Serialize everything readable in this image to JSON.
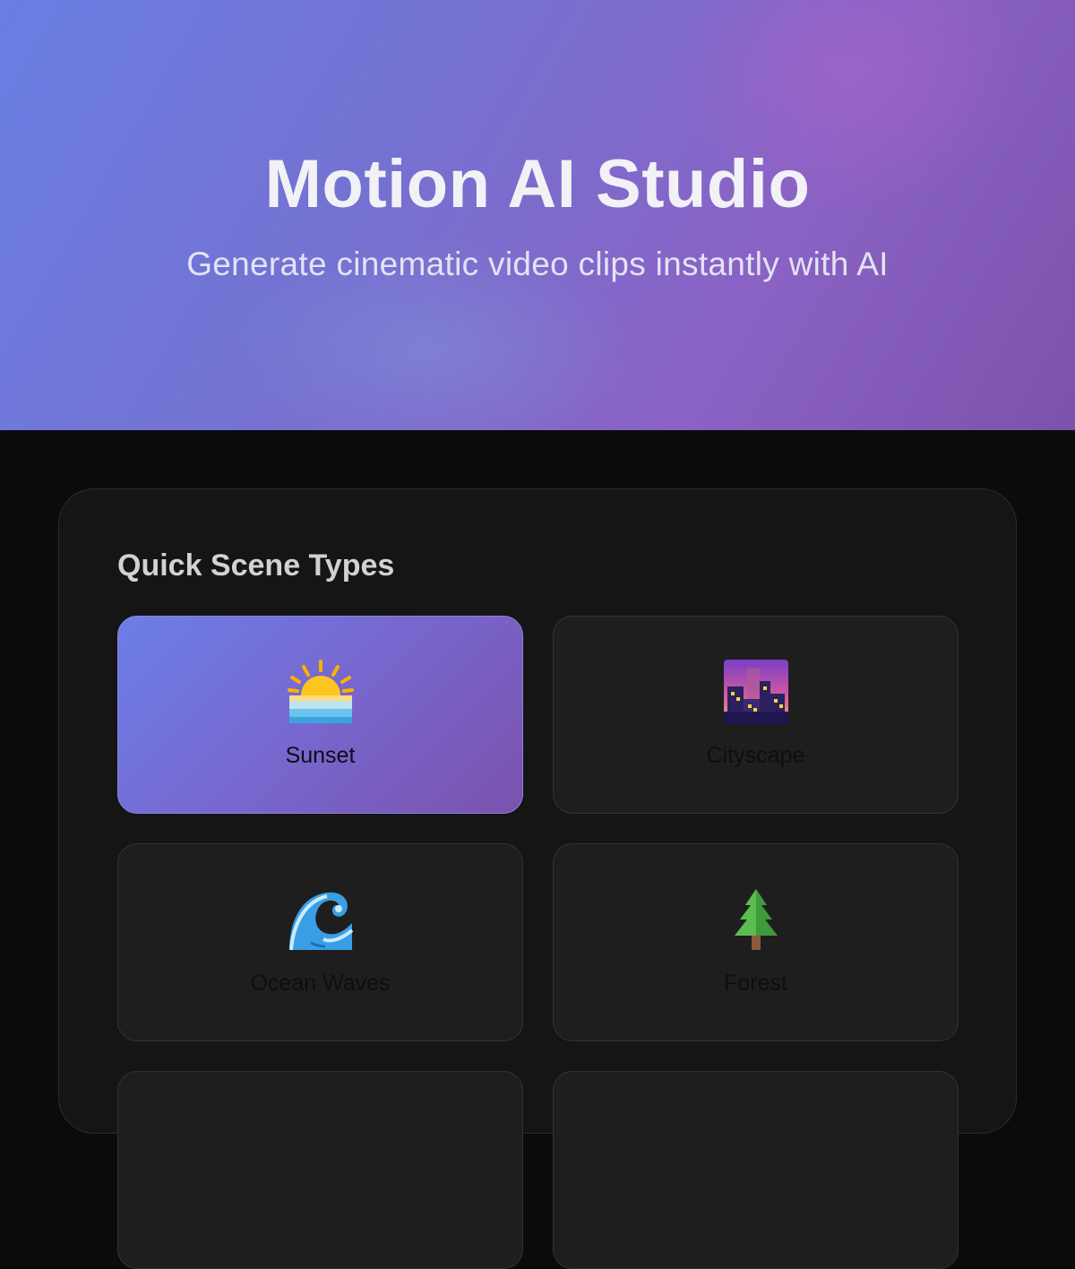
{
  "hero": {
    "title": "Motion AI Studio",
    "subtitle": "Generate cinematic video clips instantly with AI"
  },
  "scenes": {
    "heading": "Quick Scene Types",
    "items": [
      {
        "label": "Sunset",
        "icon": "sunrise-over-water-icon",
        "selected": true
      },
      {
        "label": "Cityscape",
        "icon": "city-dusk-icon",
        "selected": false
      },
      {
        "label": "Ocean Waves",
        "icon": "water-wave-icon",
        "selected": false
      },
      {
        "label": "Forest",
        "icon": "evergreen-tree-icon",
        "selected": false
      }
    ]
  },
  "colors": {
    "accent_start": "#6b7fe7",
    "accent_end": "#7b52ad",
    "background": "#0b0b0b",
    "panel": "#151515",
    "card": "#1e1e1e"
  }
}
